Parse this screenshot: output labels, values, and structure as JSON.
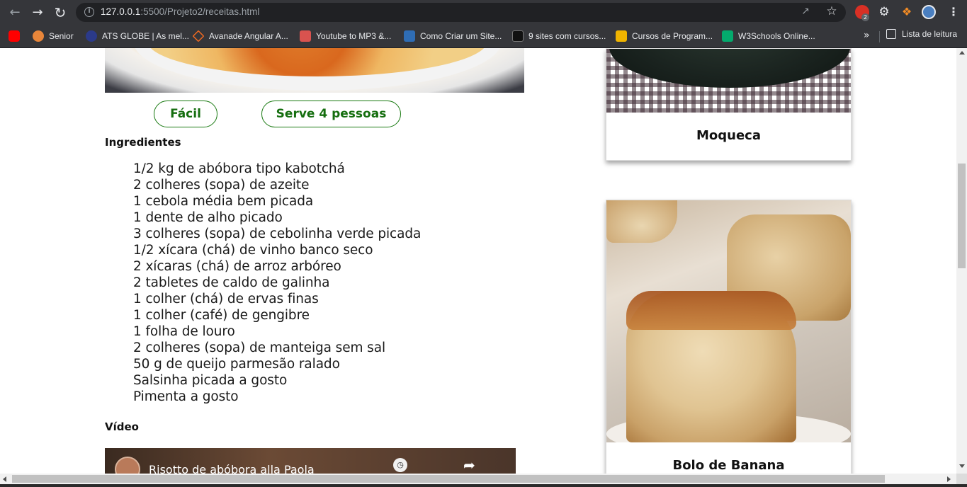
{
  "browser": {
    "url_host": "127.0.0.1",
    "url_rest": ":5500/Projeto2/receitas.html",
    "extension_badge": "2",
    "bookmarks": [
      {
        "label": "",
        "icon": "youtube-icon",
        "color": "#ff0000"
      },
      {
        "label": "Senior",
        "icon": "senior-icon",
        "color": "#e8863a"
      },
      {
        "label": "ATS GLOBE | As mel...",
        "icon": "ats-globe-icon",
        "color": "#2b3a8a"
      },
      {
        "label": "Avanade Angular A...",
        "icon": "avanade-icon",
        "color": "#f26a21"
      },
      {
        "label": "Youtube to MP3 &...",
        "icon": "mp3-icon",
        "color": "#d9534f"
      },
      {
        "label": "Como Criar um Site...",
        "icon": "wordpress-icon",
        "color": "#2f6db5"
      },
      {
        "label": "9 sites com cursos...",
        "icon": "sites-icon",
        "color": "#111111"
      },
      {
        "label": "Cursos de Program...",
        "icon": "cursos-icon",
        "color": "#f0b400"
      },
      {
        "label": "W3Schools Online...",
        "icon": "w3schools-icon",
        "color": "#04aa6d"
      }
    ],
    "more_bookmarks": "»",
    "reading_list": "Lista de leitura"
  },
  "recipe": {
    "difficulty": "Fácil",
    "servings": "Serve 4 pessoas",
    "ingredients_title": "Ingredientes",
    "ingredients": [
      "1/2 kg de abóbora tipo kabotchá",
      "2 colheres (sopa) de azeite",
      "1 cebola média bem picada",
      "1 dente de alho picado",
      "3 colheres (sopa) de cebolinha verde picada",
      "1/2 xícara (chá) de vinho banco seco",
      "2 xícaras (chá) de arroz arbóreo",
      "2 tabletes de caldo de galinha",
      "1 colher (chá) de ervas finas",
      "1 colher (café) de gengibre",
      "1 folha de louro",
      "2 colheres (sopa) de manteiga sem sal",
      "50 g de queijo parmesão ralado",
      "Salsinha picada a gosto",
      "Pimenta a gosto"
    ],
    "video_title": "Vídeo",
    "video_caption": "Risotto de abóbora alla Paola"
  },
  "sidebar_cards": [
    {
      "label": "Moqueca"
    },
    {
      "label": "Bolo de Banana"
    }
  ],
  "colors": {
    "accent_green": "#156e0f",
    "chrome_dark": "#35363a"
  }
}
